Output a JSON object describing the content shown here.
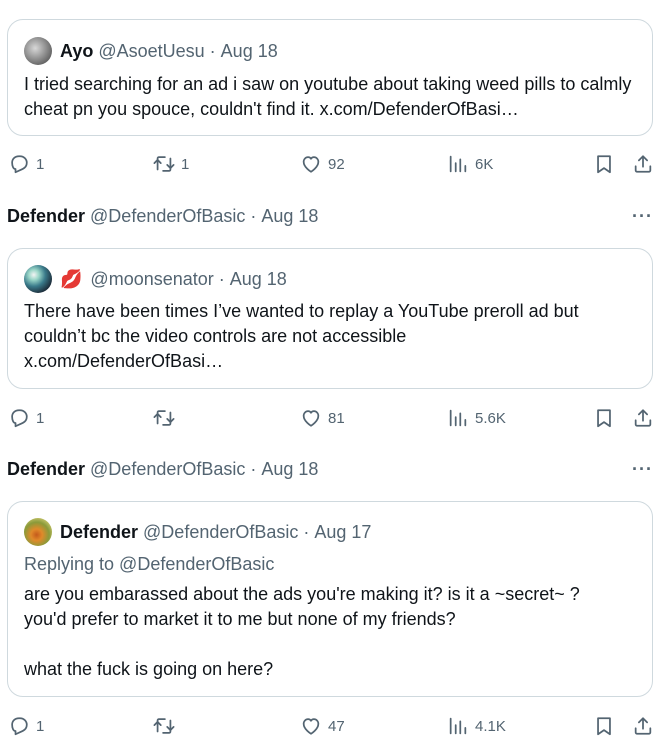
{
  "posts": [
    {
      "quote": {
        "name": "Ayo",
        "handle": "@AsoetUesu",
        "sep": "·",
        "date": "Aug 18",
        "text": "I tried searching for an ad i saw on youtube about taking weed pills to calmly cheat pn you spouce, couldn't find it. x.com/DefenderOfBasi…"
      },
      "actions": {
        "replies": "1",
        "reposts": "1",
        "likes": "92",
        "views": "6K"
      }
    },
    {
      "author": {
        "name": "Defender",
        "handle": "@DefenderOfBasic",
        "sep": "·",
        "date": "Aug 18",
        "more": "···"
      },
      "quote": {
        "emoji": "💋",
        "handle": "@moonsenator",
        "sep": "·",
        "date": "Aug 18",
        "text": "There have been times I’ve wanted to replay a YouTube preroll ad but\ncouldn’t bc the video controls are not accessible\nx.com/DefenderOfBasi…"
      },
      "actions": {
        "replies": "1",
        "reposts": "",
        "likes": "81",
        "views": "5.6K"
      }
    },
    {
      "author": {
        "name": "Defender",
        "handle": "@DefenderOfBasic",
        "sep": "·",
        "date": "Aug 18",
        "more": "···"
      },
      "quote": {
        "name": "Defender",
        "handle": "@DefenderOfBasic",
        "sep": "·",
        "date": "Aug 17",
        "replying_to": "Replying to @DefenderOfBasic",
        "text": "are you embarassed about the ads you're making it? is it a ~secret~ ?\nyou'd prefer to market it to me but none of my friends?\n\nwhat the fuck is going on here?"
      },
      "actions": {
        "replies": "1",
        "reposts": "",
        "likes": "47",
        "views": "4.1K"
      }
    }
  ],
  "colors": {
    "text": "#0f1419",
    "secondary": "#536471",
    "border": "#cfd9de"
  },
  "icons": [
    "reply-icon",
    "repost-icon",
    "like-icon",
    "views-icon",
    "bookmark-icon",
    "share-icon",
    "more-icon"
  ]
}
